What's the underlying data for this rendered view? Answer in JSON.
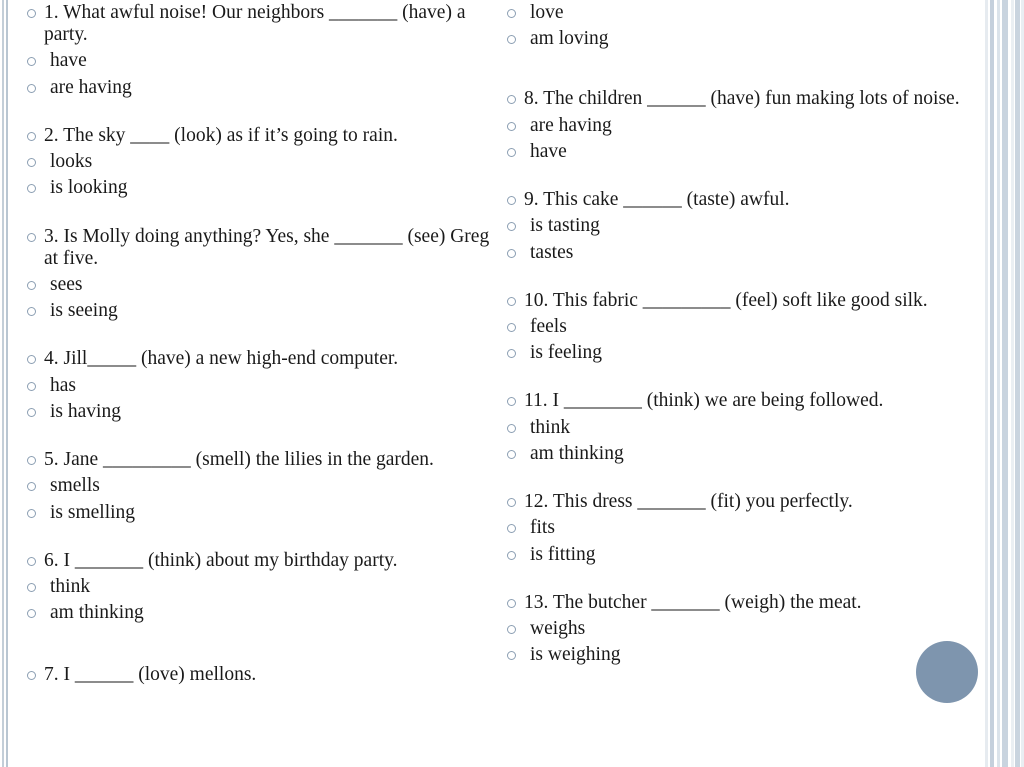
{
  "slide": {
    "background_color": "#ffffff",
    "text_color": "#1a1a1a",
    "bullet_color": "#8c9fb3",
    "accent_color": "#7e95ae",
    "edge_bar_color": "#c5d0dc",
    "decor_circle_color": "#7e95ae"
  },
  "left_column": [
    {
      "question": "1. What awful noise! Our neighbors _______ (have) a party.",
      "options": [
        "have",
        "are having"
      ]
    },
    {
      "question": "2. The sky ____ (look) as if it’s going to rain.",
      "options": [
        "looks",
        "is looking"
      ]
    },
    {
      "question": "3. Is Molly doing anything? Yes, she _______ (see) Greg at five.",
      "options": [
        "sees",
        "is seeing"
      ]
    },
    {
      "question": "4. Jill_____ (have) a new high-end computer.",
      "options": [
        "has",
        "is having"
      ]
    },
    {
      "question": "5. Jane _________ (smell) the lilies in the garden.",
      "options": [
        "smells",
        "is smelling"
      ]
    },
    {
      "question": "6. I _______ (think) about my birthday party.",
      "options": [
        "think",
        "am thinking"
      ]
    },
    {
      "question": "7. I ______ (love) mellons.",
      "options": []
    }
  ],
  "right_column_carryover": {
    "options": [
      "love",
      "am loving"
    ]
  },
  "right_column": [
    {
      "question": "8. The children ______ (have) fun making lots of noise.",
      "options": [
        "are having",
        "have"
      ]
    },
    {
      "question": "9. This cake ______ (taste) awful.",
      "options": [
        "is tasting",
        "tastes"
      ]
    },
    {
      "question": "10. This fabric _________ (feel) soft like good silk.",
      "options": [
        "feels",
        "is feeling"
      ]
    },
    {
      "question": "11. I ________ (think) we are being followed.",
      "options": [
        "think",
        "am thinking"
      ]
    },
    {
      "question": "12. This dress _______ (fit) you perfectly.",
      "options": [
        "fits",
        "is fitting"
      ]
    },
    {
      "question": "13. The butcher _______ (weigh) the meat.",
      "options": [
        "weighs",
        "is weighing"
      ]
    }
  ]
}
